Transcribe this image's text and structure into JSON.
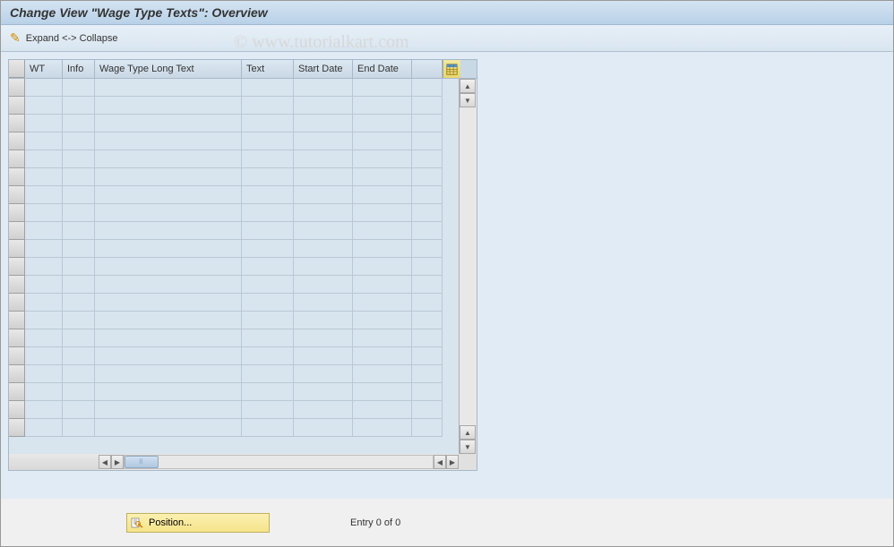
{
  "title": "Change View \"Wage Type Texts\": Overview",
  "toolbar": {
    "expand_collapse": "Expand <-> Collapse"
  },
  "watermark": "© www.tutorialkart.com",
  "table": {
    "columns": {
      "wt": "WT",
      "info": "Info",
      "longtext": "Wage Type Long Text",
      "text": "Text",
      "start": "Start Date",
      "end": "End Date"
    },
    "row_count": 20
  },
  "footer": {
    "position_label": "Position...",
    "entry_text": "Entry 0 of 0"
  }
}
